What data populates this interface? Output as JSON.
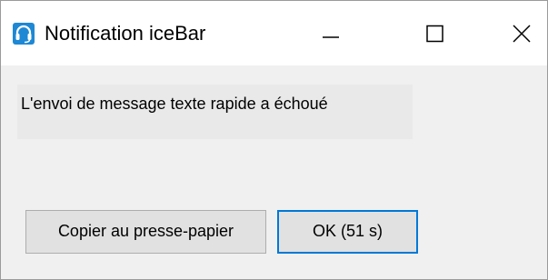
{
  "window": {
    "title": "Notification iceBar",
    "icon": "headset-icon",
    "controls": {
      "minimize_icon": "minimize-icon",
      "maximize_icon": "maximize-icon",
      "close_icon": "close-icon"
    }
  },
  "message": {
    "text": "L'envoi de message texte rapide a échoué"
  },
  "buttons": {
    "copy_label": "Copier au presse-papier",
    "ok_label": "OK (51 s)"
  },
  "colors": {
    "accent": "#0078d7",
    "icon_bg": "#1e88d4",
    "dialog_bg": "#f0f0f0"
  }
}
